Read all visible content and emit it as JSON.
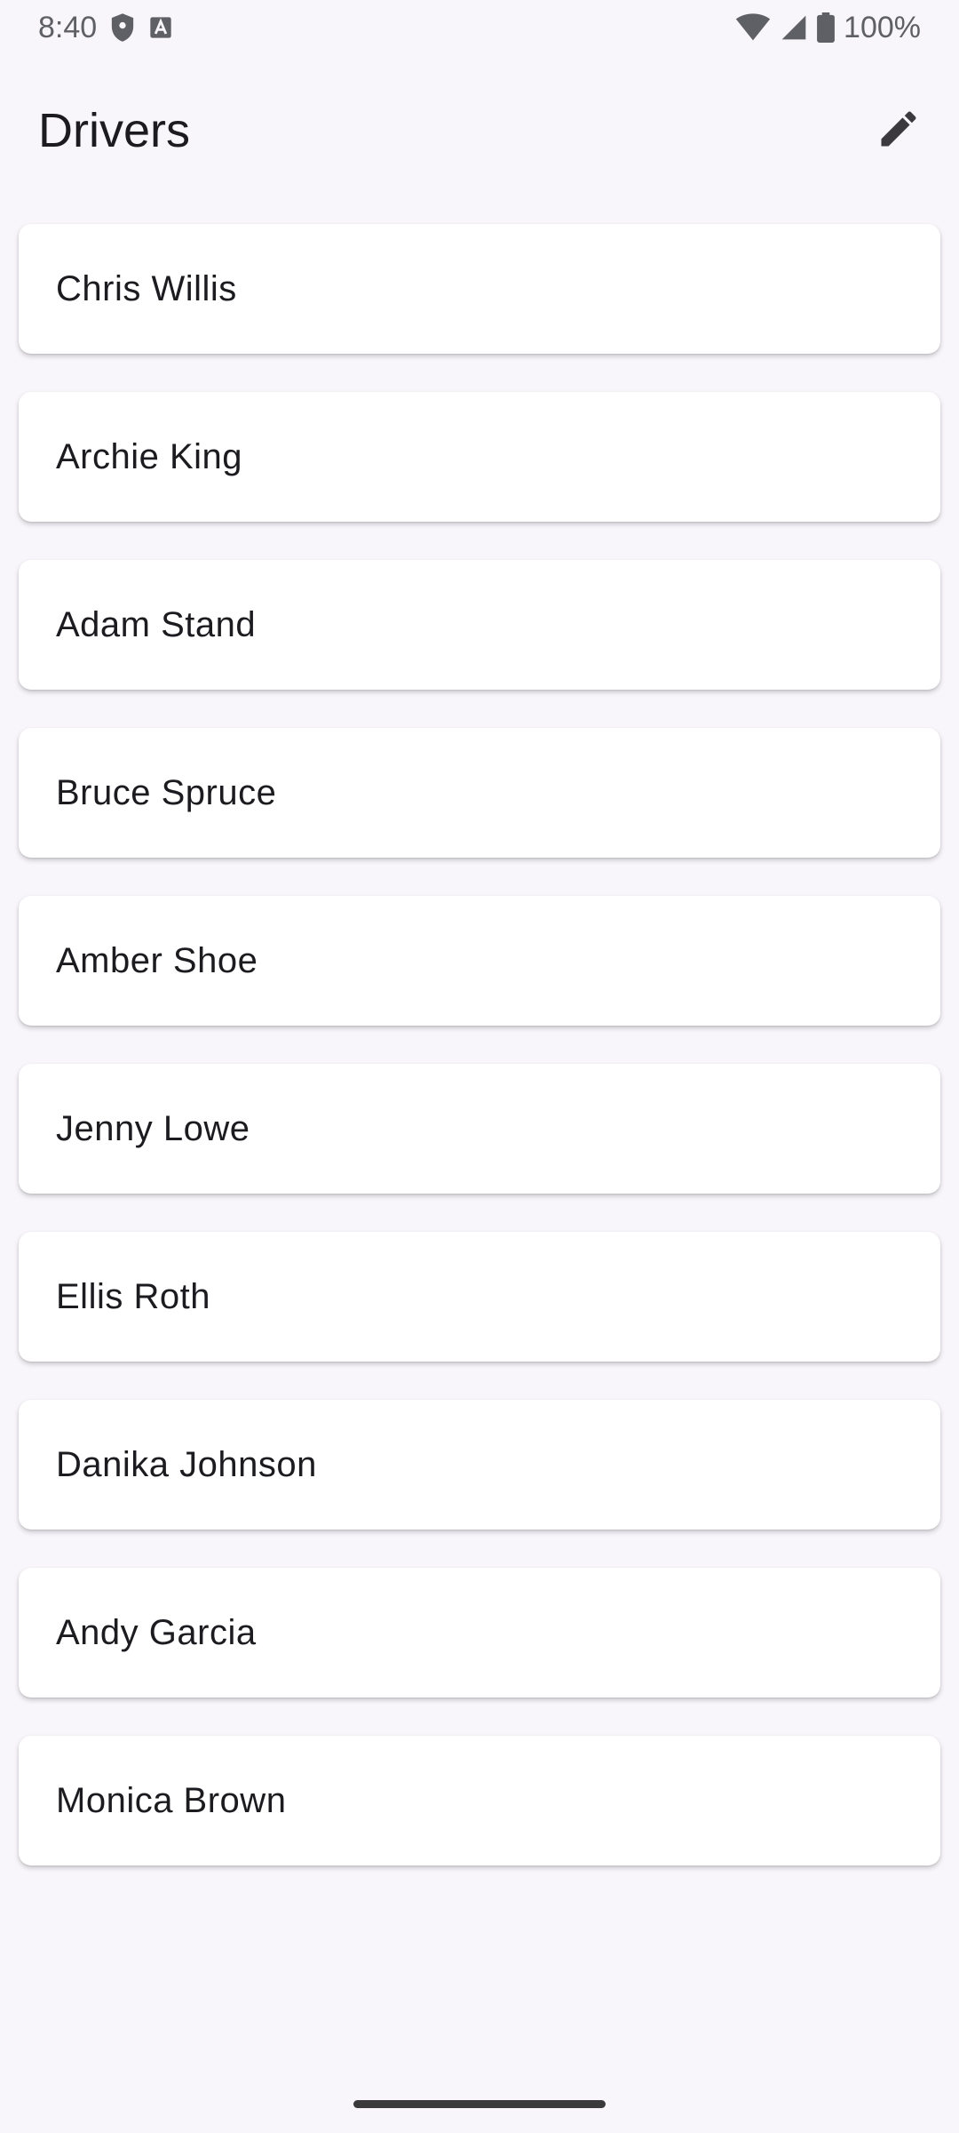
{
  "status_bar": {
    "time": "8:40",
    "battery": "100%",
    "icons": [
      "shield-icon",
      "font-a-icon",
      "wifi-icon",
      "cell-signal-icon",
      "battery-icon"
    ]
  },
  "app_bar": {
    "title": "Drivers",
    "edit_icon": "pencil-icon"
  },
  "drivers": [
    {
      "name": "Chris Willis"
    },
    {
      "name": "Archie King"
    },
    {
      "name": "Adam Stand"
    },
    {
      "name": "Bruce Spruce"
    },
    {
      "name": "Amber Shoe"
    },
    {
      "name": "Jenny Lowe"
    },
    {
      "name": "Ellis Roth"
    },
    {
      "name": "Danika Johnson"
    },
    {
      "name": "Andy Garcia"
    },
    {
      "name": "Monica Brown"
    }
  ],
  "colors": {
    "background": "#f8f6fb",
    "card": "#ffffff",
    "text": "#1c1b1f",
    "icon": "#49454f"
  }
}
